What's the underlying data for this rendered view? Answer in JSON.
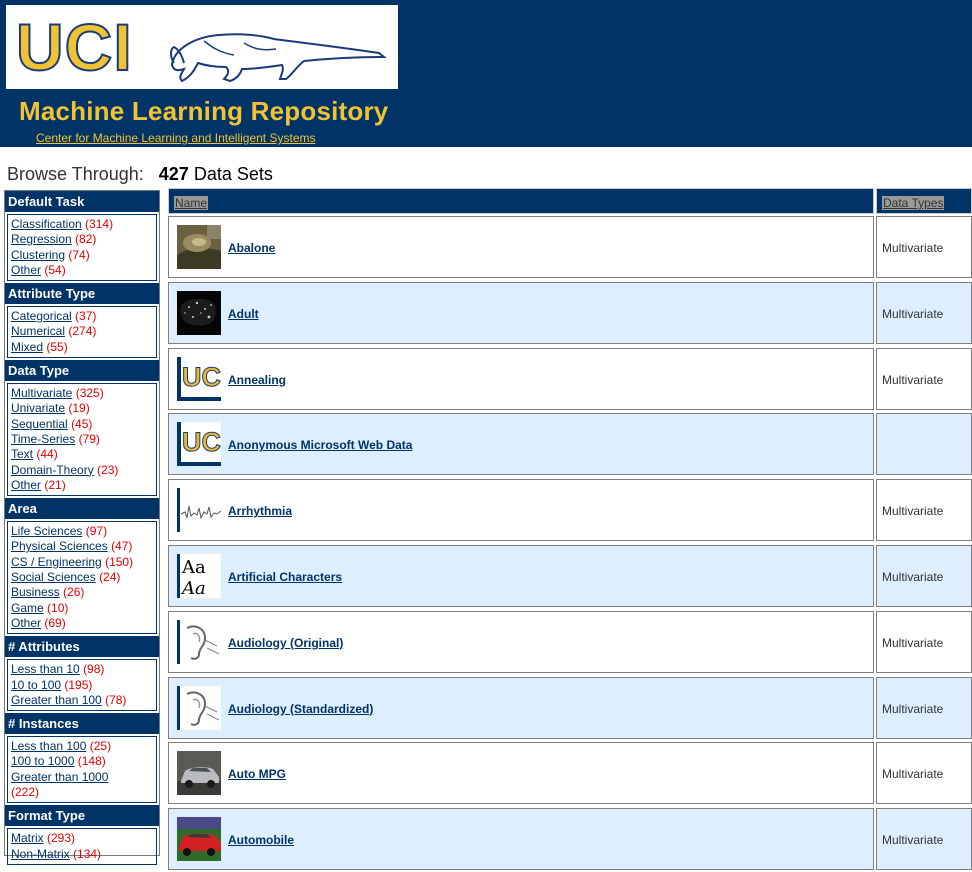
{
  "header": {
    "logo_text": "UCI",
    "title": "Machine Learning Repository",
    "subtitle_link": "Center for Machine Learning and Intelligent Systems"
  },
  "browse": {
    "label": "Browse Through:",
    "count": "427",
    "suffix": "Data Sets"
  },
  "sidebar": {
    "facets": [
      {
        "title": "Default Task",
        "items": [
          {
            "label": "Classification",
            "count": "(314)"
          },
          {
            "label": "Regression",
            "count": "(82)"
          },
          {
            "label": "Clustering",
            "count": "(74)"
          },
          {
            "label": "Other",
            "count": "(54)"
          }
        ]
      },
      {
        "title": "Attribute Type",
        "items": [
          {
            "label": "Categorical",
            "count": "(37)"
          },
          {
            "label": "Numerical",
            "count": "(274)"
          },
          {
            "label": "Mixed",
            "count": "(55)"
          }
        ]
      },
      {
        "title": "Data Type",
        "items": [
          {
            "label": "Multivariate",
            "count": "(325)"
          },
          {
            "label": "Univariate",
            "count": "(19)"
          },
          {
            "label": "Sequential",
            "count": "(45)"
          },
          {
            "label": "Time-Series",
            "count": "(79)"
          },
          {
            "label": "Text",
            "count": "(44)"
          },
          {
            "label": "Domain-Theory",
            "count": "(23)"
          },
          {
            "label": "Other",
            "count": "(21)"
          }
        ]
      },
      {
        "title": "Area",
        "items": [
          {
            "label": "Life Sciences",
            "count": "(97)"
          },
          {
            "label": "Physical Sciences",
            "count": "(47)"
          },
          {
            "label": "CS / Engineering",
            "count": "(150)"
          },
          {
            "label": "Social Sciences",
            "count": "(24)"
          },
          {
            "label": "Business",
            "count": "(26)"
          },
          {
            "label": "Game",
            "count": "(10)"
          },
          {
            "label": "Other",
            "count": "(69)"
          }
        ]
      },
      {
        "title": "# Attributes",
        "items": [
          {
            "label": "Less than 10",
            "count": "(98)"
          },
          {
            "label": "10 to 100",
            "count": "(195)"
          },
          {
            "label": "Greater than 100",
            "count": "(78)"
          }
        ]
      },
      {
        "title": "# Instances",
        "items": [
          {
            "label": "Less than 100",
            "count": "(25)"
          },
          {
            "label": "100 to 1000",
            "count": "(148)"
          },
          {
            "label": "Greater than 1000",
            "count": "(222)"
          }
        ]
      },
      {
        "title": "Format Type",
        "items": [
          {
            "label": "Matrix",
            "count": "(293)"
          },
          {
            "label": "Non-Matrix",
            "count": "(134)"
          }
        ]
      }
    ]
  },
  "table": {
    "col_name": "Name",
    "col_types": "Data Types",
    "rows": [
      {
        "name": "Abalone",
        "types": "Multivariate",
        "thumb": "abalone-photo"
      },
      {
        "name": "Adult",
        "types": "Multivariate",
        "thumb": "map-photo"
      },
      {
        "name": "Annealing",
        "types": "Multivariate",
        "thumb": "uci-logo"
      },
      {
        "name": "Anonymous Microsoft Web Data",
        "types": "",
        "thumb": "uci-logo"
      },
      {
        "name": "Arrhythmia",
        "types": "Multivariate",
        "thumb": "ecg-waveform"
      },
      {
        "name": "Artificial Characters",
        "types": "Multivariate",
        "thumb": "letters-aa"
      },
      {
        "name": "Audiology (Original)",
        "types": "Multivariate",
        "thumb": "ear-drawing"
      },
      {
        "name": "Audiology (Standardized)",
        "types": "Multivariate",
        "thumb": "ear-drawing"
      },
      {
        "name": "Auto MPG",
        "types": "Multivariate",
        "thumb": "car-photo"
      },
      {
        "name": "Automobile",
        "types": "Multivariate",
        "thumb": "red-car-photo"
      }
    ]
  },
  "colors": {
    "header_bg": "#003366",
    "gold": "#f1c232",
    "row_alt": "#ddeeff",
    "count_red": "#e00000"
  }
}
